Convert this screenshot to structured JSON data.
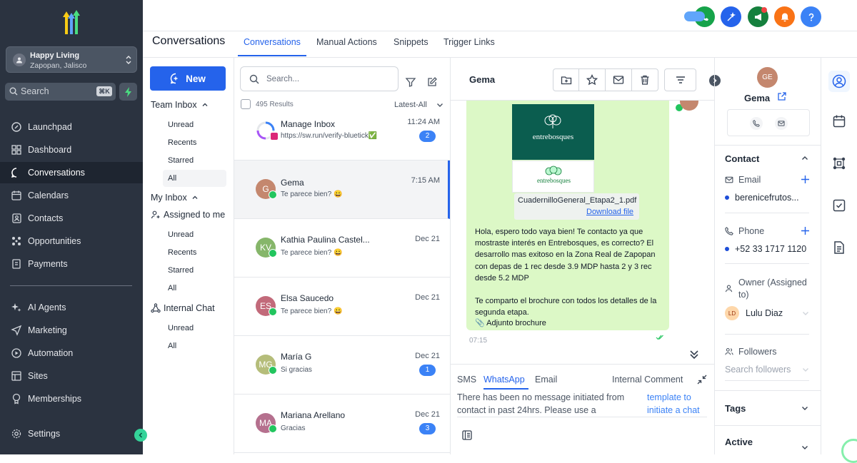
{
  "sidebar": {
    "location_name": "Happy Living",
    "location_sub": "Zapopan, Jalisco",
    "search_placeholder": "Search",
    "search_shortcut": "⌘K",
    "items": [
      {
        "label": "Launchpad",
        "icon": "rocket-icon"
      },
      {
        "label": "Dashboard",
        "icon": "grid-icon"
      },
      {
        "label": "Conversations",
        "icon": "chat-icon",
        "active": true
      },
      {
        "label": "Calendars",
        "icon": "calendar-icon"
      },
      {
        "label": "Contacts",
        "icon": "contacts-icon"
      },
      {
        "label": "Opportunities",
        "icon": "opportunities-icon"
      },
      {
        "label": "Payments",
        "icon": "payments-icon"
      },
      {
        "label": "AI Agents",
        "icon": "sparkle-icon"
      },
      {
        "label": "Marketing",
        "icon": "send-icon"
      },
      {
        "label": "Automation",
        "icon": "automation-icon"
      },
      {
        "label": "Sites",
        "icon": "sites-icon"
      },
      {
        "label": "Memberships",
        "icon": "memberships-icon"
      },
      {
        "label": "Settings",
        "icon": "gear-icon"
      }
    ]
  },
  "topbar": {
    "colors": {
      "phone": "#16a34a",
      "magic": "#2563eb",
      "megaphone": "#15803d",
      "bell": "#f97316",
      "help": "#3b82f6"
    }
  },
  "page_title": "Conversations",
  "tabs": [
    "Conversations",
    "Manual Actions",
    "Snippets",
    "Trigger Links"
  ],
  "inbox": {
    "new_label": "New",
    "team_inbox": "Team Inbox",
    "team_items": [
      "Unread",
      "Recents",
      "Starred",
      "All"
    ],
    "my_inbox": "My Inbox",
    "assigned": "Assigned to me",
    "assigned_items": [
      "Unread",
      "Recents",
      "Starred",
      "All"
    ],
    "internal_chat": "Internal Chat",
    "internal_items": [
      "Unread",
      "All"
    ]
  },
  "list": {
    "search_placeholder": "Search...",
    "results": "495 Results",
    "sort": "Latest-All",
    "conversations": [
      {
        "name": "Manage Inbox",
        "preview": "https://sw.run/verify-bluetick✅",
        "time": "11:24 AM",
        "badge": "2",
        "initials": ""
      },
      {
        "name": "Gema",
        "preview": "Te parece bien? 😀",
        "time": "7:15 AM",
        "badge": "",
        "initials": "G"
      },
      {
        "name": "Kathia Paulina Castel...",
        "preview": "Te parece bien? 😀",
        "time": "Dec 21",
        "badge": "",
        "initials": "KV"
      },
      {
        "name": "Elsa Saucedo",
        "preview": "Te parece bien? 😀",
        "time": "Dec 21",
        "badge": "",
        "initials": "ES"
      },
      {
        "name": "María G",
        "preview": "Si gracias",
        "time": "Dec 21",
        "badge": "1",
        "initials": "MG"
      },
      {
        "name": "Mariana Arellano",
        "preview": "Gracias",
        "time": "Dec 21",
        "badge": "3",
        "initials": "MA"
      }
    ]
  },
  "chat": {
    "contact_name": "Gema",
    "brand_text": "entrebosques",
    "file_name": "CuadernilloGeneral_Etapa2_1.pdf",
    "download": "Download file",
    "message": "Hola, espero todo vaya bien! Te contacto ya que mostraste interés en Entrebosques, es correcto? El desarrollo mas exitoso en la Zona Real de Zapopan con depas de 1 rec desde 3.9 MDP hasta 2 y 3 rec desde 5.2 MDP\n\nTe comparto el brochure con todos los detalles de la segunda etapa.",
    "attachment": "📎 Adjunto brochure",
    "timestamp": "07:15",
    "compose_tabs": [
      "SMS",
      "WhatsApp",
      "Email"
    ],
    "internal_comment": "Internal Comment",
    "notice_1": "There has been no message initiated from",
    "notice_2": "contact in past 24hrs. Please use a",
    "notice_link_1": "template to",
    "notice_link_2": "initiate a chat"
  },
  "contact": {
    "initials": "GE",
    "name": "Gema",
    "section": "Contact",
    "email_label": "Email",
    "email_value": "berenicefrutos...",
    "phone_label": "Phone",
    "phone_value": "+52 33 1717 1120",
    "owner_label_1": "Owner (Assigned",
    "owner_label_2": "to)",
    "owner_initials": "LD",
    "owner_value": "Lulu Diaz",
    "followers_label": "Followers",
    "followers_placeholder": "Search followers",
    "tags": "Tags",
    "active": "Active"
  }
}
